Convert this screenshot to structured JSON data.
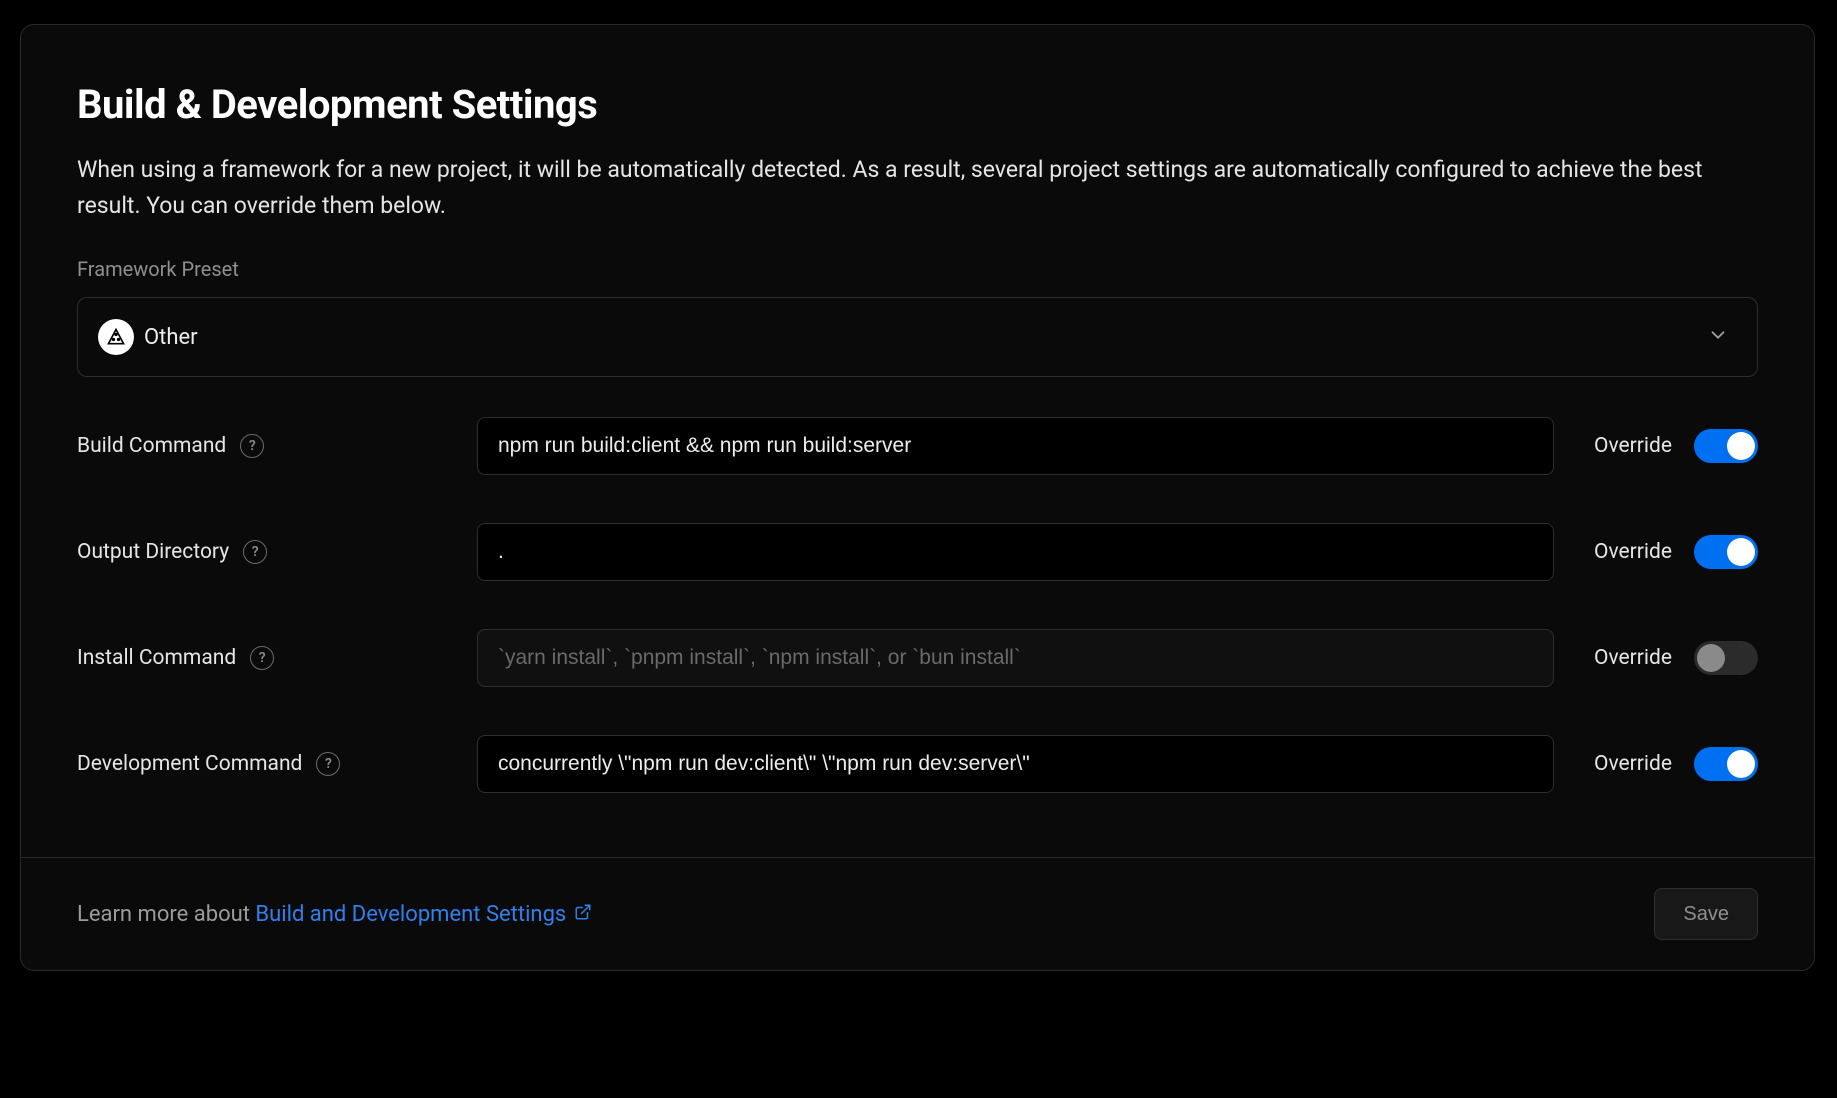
{
  "card": {
    "title": "Build & Development Settings",
    "description": "When using a framework for a new project, it will be automatically detected. As a result, several project settings are automatically configured to achieve the best result. You can override them below."
  },
  "preset": {
    "label": "Framework Preset",
    "selected": "Other"
  },
  "override_label": "Override",
  "fields": {
    "build_command": {
      "label": "Build Command",
      "value": "npm run build:client && npm run build:server",
      "placeholder": "",
      "override": true
    },
    "output_directory": {
      "label": "Output Directory",
      "value": ".",
      "placeholder": "",
      "override": true
    },
    "install_command": {
      "label": "Install Command",
      "value": "",
      "placeholder": "`yarn install`, `pnpm install`, `npm install`, or `bun install`",
      "override": false
    },
    "development_command": {
      "label": "Development Command",
      "value": "concurrently \\\"npm run dev:client\\\" \\\"npm run dev:server\\\"",
      "placeholder": "",
      "override": true
    }
  },
  "footer": {
    "prefix": "Learn more about ",
    "link_text": "Build and Development Settings",
    "save": "Save"
  }
}
